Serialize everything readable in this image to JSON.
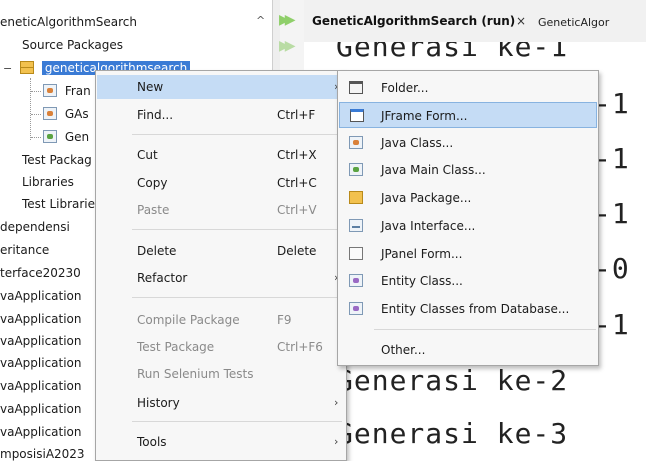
{
  "tree": {
    "items": [
      {
        "label": "eneticAlgorithmSearch"
      },
      {
        "label": "Source Packages"
      },
      {
        "label": "geneticalgorithmsearch"
      },
      {
        "label": "Fran"
      },
      {
        "label": "GAs"
      },
      {
        "label": "Gen"
      },
      {
        "label": "Test Packag"
      },
      {
        "label": "Libraries"
      },
      {
        "label": "Test Librarie"
      },
      {
        "label": "dependensi"
      },
      {
        "label": "eritance"
      },
      {
        "label": "terface20230"
      },
      {
        "label": "vaApplication"
      },
      {
        "label": "vaApplication"
      },
      {
        "label": "vaApplication"
      },
      {
        "label": "vaApplication"
      },
      {
        "label": "vaApplication"
      },
      {
        "label": "vaApplication"
      },
      {
        "label": "vaApplication"
      },
      {
        "label": "mposisiA2023"
      }
    ]
  },
  "editor": {
    "active_tab": "GeneticAlgorithmSearch (run)",
    "close_glyph": "×",
    "other_tab": "GeneticAlgor",
    "output_lines": [
      "Generasi ke-1",
      "-1",
      "-1",
      "-1",
      "-0",
      "-1",
      "Generasi ke-2",
      "Generasi ke-3"
    ]
  },
  "context_menu": {
    "items": [
      {
        "label": "New",
        "shortcut": "",
        "submenu": true
      },
      {
        "label": "Find...",
        "shortcut": "Ctrl+F"
      },
      {
        "label": "Cut",
        "shortcut": "Ctrl+X"
      },
      {
        "label": "Copy",
        "shortcut": "Ctrl+C"
      },
      {
        "label": "Paste",
        "shortcut": "Ctrl+V"
      },
      {
        "label": "Delete",
        "shortcut": "Delete"
      },
      {
        "label": "Refactor",
        "shortcut": "",
        "submenu": true
      },
      {
        "label": "Compile Package",
        "shortcut": "F9"
      },
      {
        "label": "Test Package",
        "shortcut": "Ctrl+F6"
      },
      {
        "label": "Run Selenium Tests",
        "shortcut": ""
      },
      {
        "label": "History",
        "shortcut": "",
        "submenu": true
      },
      {
        "label": "Tools",
        "shortcut": "",
        "submenu": true
      }
    ]
  },
  "submenu": {
    "items": [
      {
        "label": "Folder...",
        "icon": "folder-icon"
      },
      {
        "label": "JFrame Form...",
        "icon": "jframe-form-icon"
      },
      {
        "label": "Java Class...",
        "icon": "java-class-icon"
      },
      {
        "label": "Java Main Class...",
        "icon": "java-main-class-icon"
      },
      {
        "label": "Java Package...",
        "icon": "java-package-icon"
      },
      {
        "label": "Java Interface...",
        "icon": "java-interface-icon"
      },
      {
        "label": "JPanel Form...",
        "icon": "jpanel-form-icon"
      },
      {
        "label": "Entity Class...",
        "icon": "entity-class-icon"
      },
      {
        "label": "Entity Classes from Database...",
        "icon": "entity-classes-db-icon"
      },
      {
        "label": "Other...",
        "icon": ""
      }
    ]
  },
  "glyphs": {
    "chevron_right": "›",
    "chevron_up": "^",
    "collapse": "−",
    "run": "▶▶"
  },
  "colors": {
    "selection": "#3a7bd5",
    "menu_hover": "#c5dcf5",
    "run_green": "#8fcf6a"
  }
}
